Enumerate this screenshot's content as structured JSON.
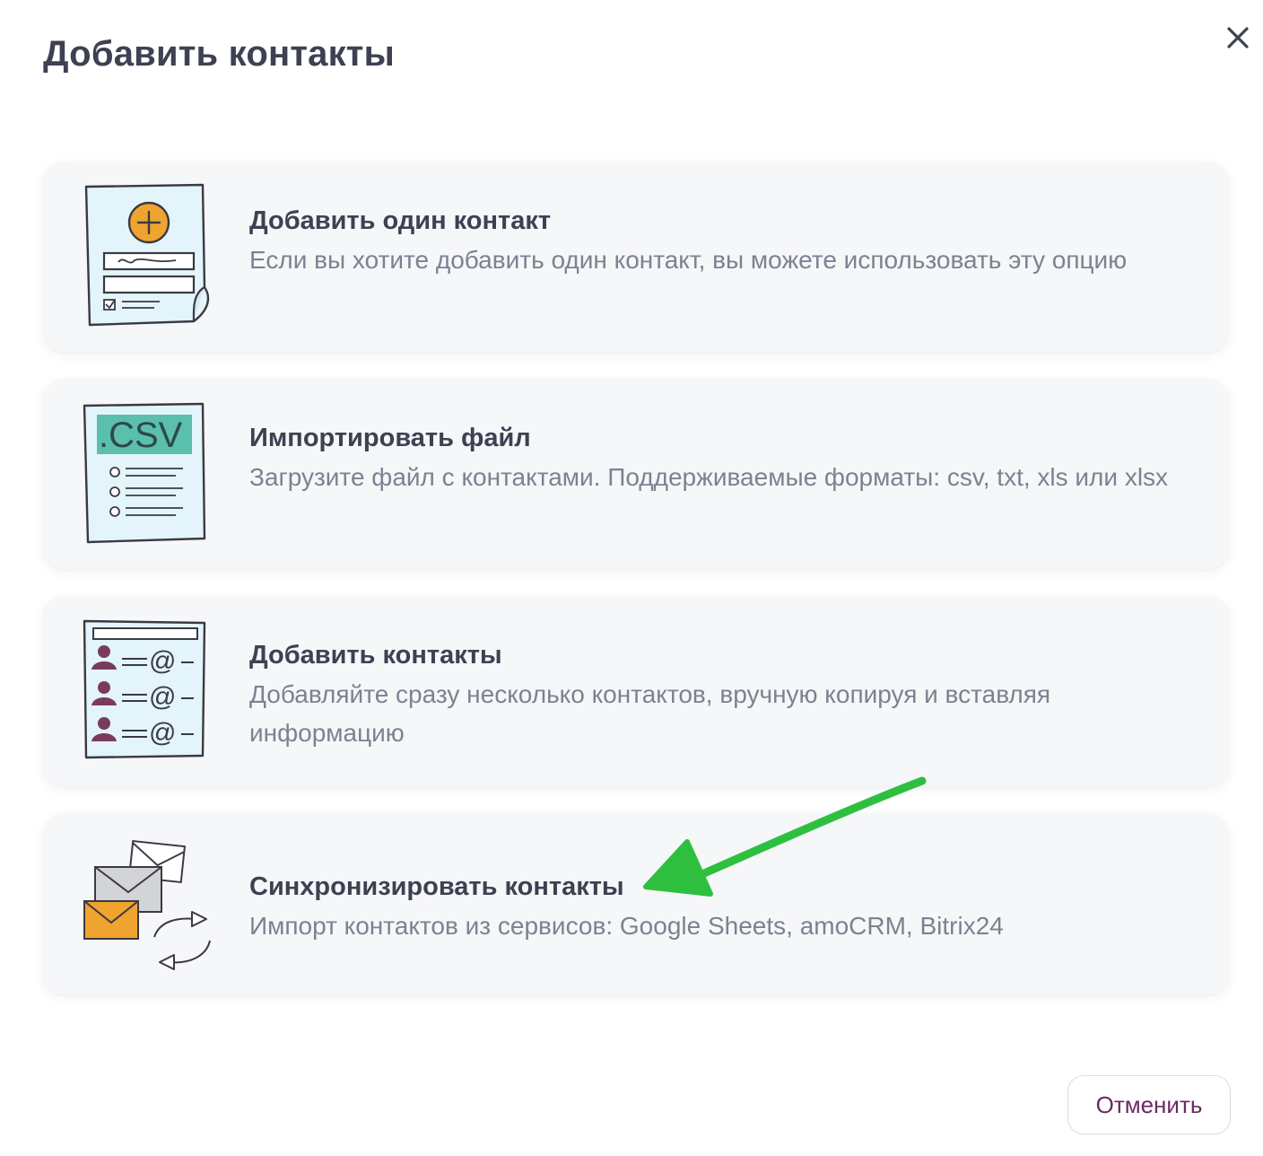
{
  "modal": {
    "title": "Добавить контакты",
    "close_icon": "close-icon"
  },
  "options": [
    {
      "title": "Добавить один контакт",
      "description": "Если вы хотите добавить один контакт, вы можете использовать эту опцию",
      "icon": "single-contact-form-icon"
    },
    {
      "title": "Импортировать файл",
      "description": "Загрузите файл с контактами. Поддерживаемые форматы: csv, txt, xls или xlsx",
      "icon": "csv-file-icon",
      "icon_label": ".CSV"
    },
    {
      "title": "Добавить контакты",
      "description": "Добавляйте сразу несколько контактов, вручную копируя и вставляя информацию",
      "icon": "contact-list-icon"
    },
    {
      "title": "Синхронизировать контакты",
      "description": "Импорт контактов из сервисов: Google Sheets, amoCRM, Bitrix24",
      "icon": "sync-envelopes-icon"
    }
  ],
  "footer": {
    "cancel_label": "Отменить"
  },
  "colors": {
    "title": "#3d4152",
    "description": "#7e8190",
    "card_bg": "#f6f7f9",
    "cancel_text": "#6b2a63",
    "accent_orange": "#f0a430",
    "csv_teal": "#5bbfae",
    "icon_paper": "#e3f4fb",
    "person_plum": "#7a3a5e",
    "annotation_arrow": "#2fbf3f"
  }
}
